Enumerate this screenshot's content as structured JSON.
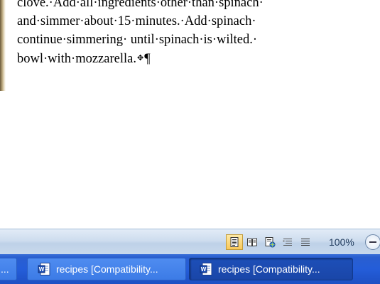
{
  "document": {
    "lines": [
      "clove.·Add·all·ingredients·other·than·spinach·",
      "and·simmer·about·15·minutes.·Add·spinach·",
      "continue·simmering· until·spinach·is·wilted.·",
      "bowl·with·mozzarella.",
      "¶"
    ],
    "text_color": "#000000"
  },
  "statusbar": {
    "view_buttons": [
      {
        "name": "print-layout-view-icon",
        "active": true
      },
      {
        "name": "full-screen-reading-view-icon",
        "active": false
      },
      {
        "name": "web-layout-view-icon",
        "active": false
      },
      {
        "name": "outline-view-icon",
        "active": false
      },
      {
        "name": "draft-view-icon",
        "active": false
      }
    ],
    "zoom_level": "100%"
  },
  "taskbar": {
    "buttons": [
      {
        "label": "...",
        "active": false
      },
      {
        "label": "recipes [Compatibility...",
        "active": false
      },
      {
        "label": "recipes [Compatibility...",
        "active": true
      }
    ],
    "accent": "#245dd9"
  }
}
